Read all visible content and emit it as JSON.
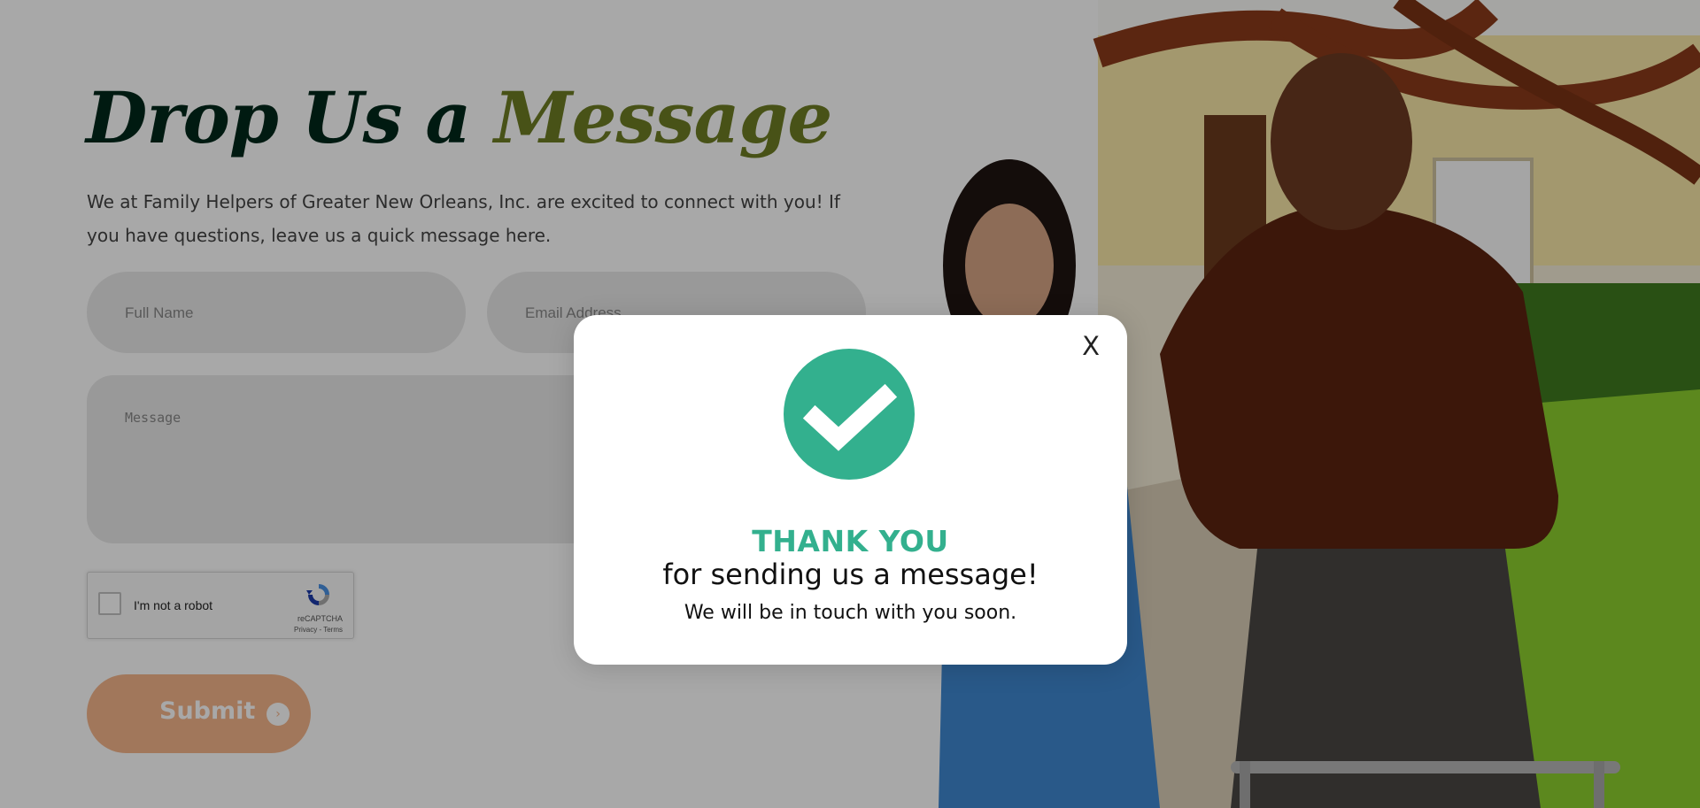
{
  "form": {
    "heading_dark": "Drop Us a",
    "heading_accent": "Message",
    "intro": "We at Family Helpers of Greater New Orleans, Inc. are excited to connect with you! If you have questions, leave us a quick message here.",
    "full_name_placeholder": "Full Name",
    "email_placeholder": "Email Address",
    "message_placeholder": "Message",
    "recaptcha": {
      "label": "I'm not a robot",
      "brand": "reCAPTCHA",
      "terms": "Privacy - Terms"
    },
    "submit_label": "Submit"
  },
  "modal": {
    "close_label": "X",
    "title": "THANK YOU",
    "line1": "for sending us a message!",
    "line2": "We will be in touch with you soon."
  },
  "colors": {
    "heading_dark": "#00281a",
    "heading_accent": "#6e7d24",
    "submit_bg": "#f4b58b",
    "success_green": "#33b08e",
    "overlay": "rgba(0,0,0,0.34)"
  },
  "icons": {
    "modal_icon": "check-circle-icon",
    "submit_icon": "arrow-circle-icon",
    "recaptcha_icon": "recaptcha-logo-icon"
  }
}
